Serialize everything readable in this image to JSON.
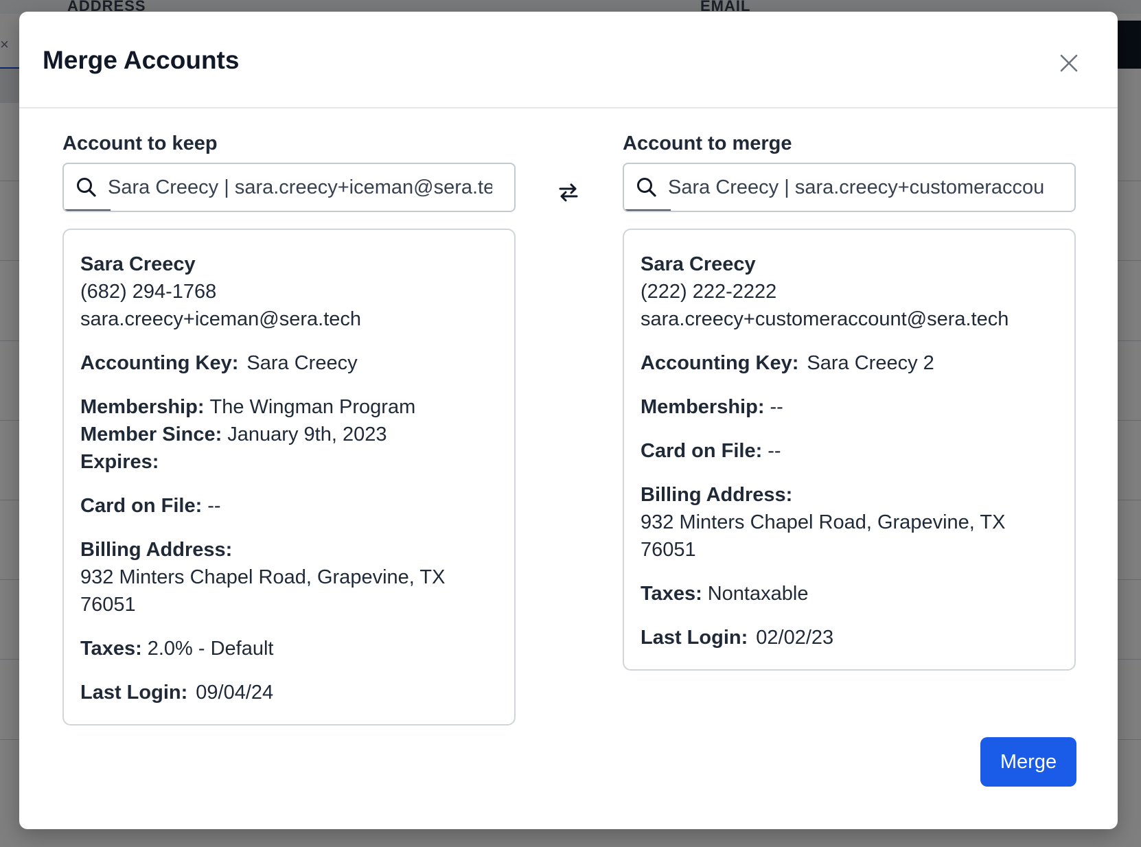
{
  "background": {
    "columns": [
      "ADDRESS",
      "EMAIL"
    ],
    "close_glyph": "×"
  },
  "modal": {
    "title": "Merge Accounts",
    "close_icon": "close-icon",
    "swap_icon": "swap-arrows-icon",
    "merge_label": "Merge",
    "accent_color": "#1a5ce8"
  },
  "keep": {
    "label": "Account to keep",
    "search_value": "Sara Creecy | sara.creecy+iceman@sera.te",
    "name": "Sara Creecy",
    "phone": "(682) 294-1768",
    "email": "sara.creecy+iceman@sera.tech",
    "accounting_key_label": "Accounting Key:",
    "accounting_key": "Sara Creecy",
    "membership_label": "Membership:",
    "membership": "The Wingman Program",
    "member_since_label": "Member Since:",
    "member_since": "January 9th, 2023",
    "expires_label": "Expires:",
    "card_label": "Card on File:",
    "card": "--",
    "billing_label": "Billing Address:",
    "billing_line1": "932 Minters Chapel Road, Grapevine, TX",
    "billing_line2": "76051",
    "taxes_label": "Taxes:",
    "taxes": "2.0% - Default",
    "last_login_label": "Last Login:",
    "last_login": "09/04/24"
  },
  "merge": {
    "label": "Account to merge",
    "search_value": "Sara Creecy | sara.creecy+customeraccou",
    "name": "Sara Creecy",
    "phone": "(222) 222-2222",
    "email": "sara.creecy+customeraccount@sera.tech",
    "accounting_key_label": "Accounting Key:",
    "accounting_key": "Sara Creecy 2",
    "membership_label": "Membership:",
    "membership": "--",
    "card_label": "Card on File:",
    "card": "--",
    "billing_label": "Billing Address:",
    "billing_line1": "932 Minters Chapel Road, Grapevine, TX",
    "billing_line2": "76051",
    "taxes_label": "Taxes:",
    "taxes": "Nontaxable",
    "last_login_label": "Last Login:",
    "last_login": "02/02/23"
  }
}
